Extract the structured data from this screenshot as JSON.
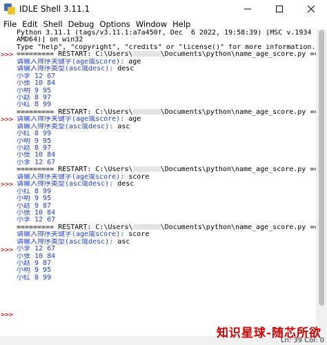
{
  "window": {
    "title": "IDLE Shell 3.11.1"
  },
  "menu": [
    "File",
    "Edit",
    "Shell",
    "Debug",
    "Options",
    "Window",
    "Help"
  ],
  "shell": {
    "prompt": ">>>",
    "banner": [
      "Python 3.11.1 (tags/v3.11.1:a7a450f, Dec  6 2022, 19:58:39) [MSC v.1934 64 bit (",
      "AMD64)] on win32",
      "Type \"help\", \"copyright\", \"credits\" or \"license()\" for more information."
    ],
    "runs": [
      {
        "restart_prefix": "========= RESTART: C:\\Users\\",
        "restart_suffix": "\\Documents\\python\\name_age_score.py =========",
        "q1": "请输入排序关键字(age或score): ",
        "a1": "age",
        "q2": "请输入排序类型(asc或desc): ",
        "a2": "desc",
        "results": [
          "小李 12 67",
          "小张 10 84",
          "小明 9 95",
          "小赵 8 97",
          "小红 8 99"
        ]
      },
      {
        "restart_prefix": "========= RESTART: C:\\Users\\",
        "restart_suffix": "\\Documents\\python\\name_age_score.py =========",
        "q1": "请输入排序关键字(age或score): ",
        "a1": "age",
        "q2": "请输入排序类型(asc或desc): ",
        "a2": "asc",
        "results": [
          "小红 8 99",
          "小明 9 95",
          "小赵 8 97",
          "小张 10 84",
          "小李 12 67"
        ]
      },
      {
        "restart_prefix": "========= RESTART: C:\\Users\\",
        "restart_suffix": "\\Documents\\python\\name_age_score.py =========",
        "q1": "请输入排序关键字(age或score): ",
        "a1": "score",
        "q2": "请输入排序类型(asc或desc): ",
        "a2": "desc",
        "results": [
          "小红 8 99",
          "小明 9 95",
          "小赵 9 87",
          "小张 10 84",
          "小李 12 67"
        ]
      },
      {
        "restart_prefix": "========= RESTART: C:\\Users\\",
        "restart_suffix": "\\Documents\\python\\name_age_score.py =========",
        "q1": "请输入排序关键字(age或score): ",
        "a1": "score",
        "q2": "请输入排序类型(asc或desc): ",
        "a2": "asc",
        "results": [
          "小李 12 67",
          "小张 10 84",
          "小赵 9 87",
          "小明 9 95",
          "小红 8 99"
        ]
      }
    ]
  },
  "status": {
    "text": "Ln: 39  Col: 0"
  },
  "watermark": "知识星球-随芯所欲",
  "colors": {
    "stdout": "#1f3fd6",
    "prompt": "#c00000",
    "watermark": "#d10000"
  }
}
